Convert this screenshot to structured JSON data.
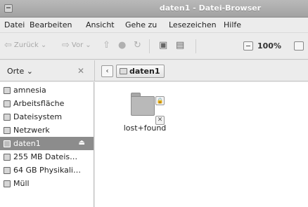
{
  "window": {
    "title": "daten1 - Datei-Browser"
  },
  "menubar": {
    "items": [
      "Datei",
      "Bearbeiten",
      "Ansicht",
      "Gehe zu",
      "Lesezeichen",
      "Hilfe"
    ]
  },
  "toolbar": {
    "back_label": "Zurück",
    "forward_label": "Vor",
    "zoom_level": "100%"
  },
  "sidebar": {
    "header": "Orte",
    "items": [
      {
        "label": "amnesia",
        "icon": "home-folder-icon"
      },
      {
        "label": "Arbeitsfläche",
        "icon": "desktop-icon"
      },
      {
        "label": "Dateisystem",
        "icon": "drive-icon"
      },
      {
        "label": "Netzwerk",
        "icon": "network-icon"
      },
      {
        "label": "daten1",
        "icon": "drive-icon",
        "selected": true
      },
      {
        "label": "255 MB Dateis…",
        "icon": "drive-icon"
      },
      {
        "label": "64 GB Physikali…",
        "icon": "drive-icon"
      },
      {
        "label": "Müll",
        "icon": "trash-icon"
      }
    ]
  },
  "pathbar": {
    "current": "daten1"
  },
  "content": {
    "items": [
      {
        "label": "lost+found",
        "icon": "folder-icon"
      }
    ]
  }
}
